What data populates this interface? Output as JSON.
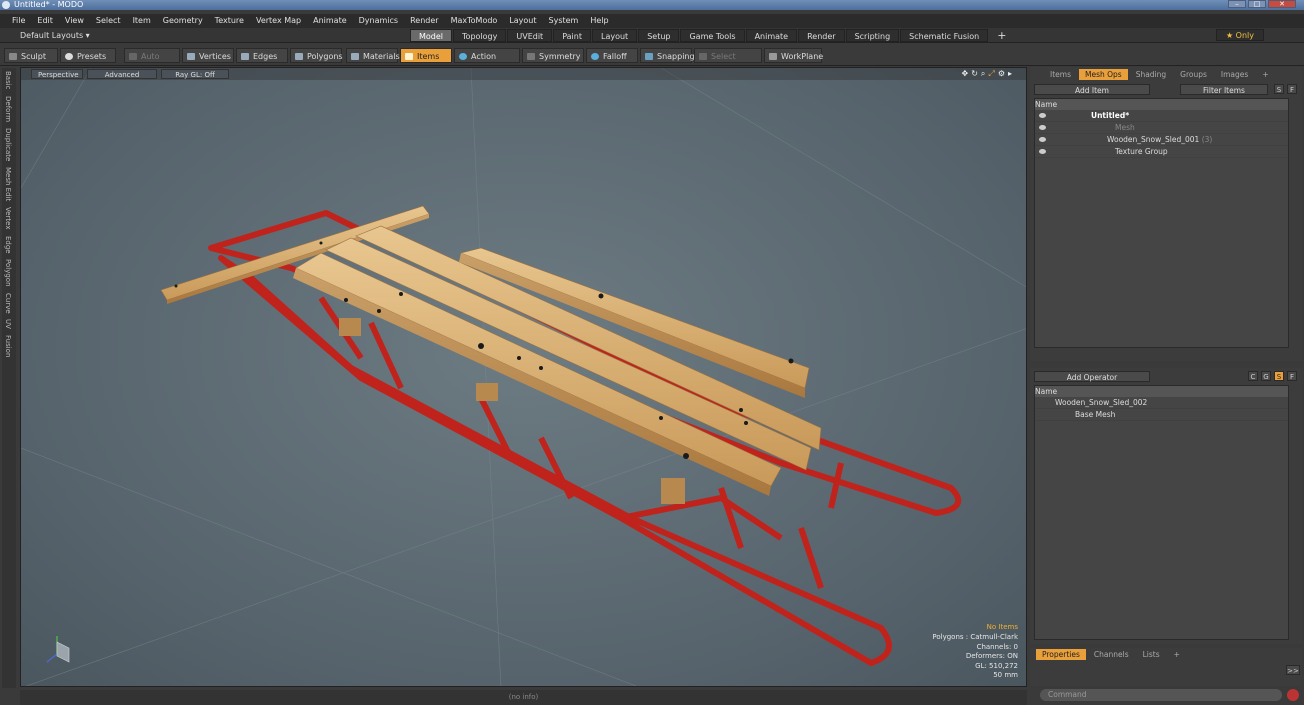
{
  "window": {
    "title": "Untitled* - MODO"
  },
  "menu": [
    "File",
    "Edit",
    "View",
    "Select",
    "Item",
    "Geometry",
    "Texture",
    "Vertex Map",
    "Animate",
    "Dynamics",
    "Render",
    "MaxToModo",
    "Layout",
    "System",
    "Help"
  ],
  "layout": {
    "dropdown": "Default Layouts ▾",
    "tabs": [
      "Model",
      "Topology",
      "UVEdit",
      "Paint",
      "Layout",
      "Setup",
      "Game Tools",
      "Animate",
      "Render",
      "Scripting",
      "Schematic Fusion"
    ],
    "active_tab": "Model",
    "plus": "+",
    "only": "★ Only"
  },
  "toolbar": {
    "sculpt": "Sculpt",
    "presets": "Presets",
    "presets_key": "F6",
    "auto_select": "Auto Select",
    "vertices": "Vertices",
    "vertices_n": "1",
    "edges": "Edges",
    "edges_n": "2",
    "polygons": "Polygons",
    "materials": "Materials",
    "items": "Items",
    "action_center": "Action Center",
    "symmetry": "Symmetry",
    "falloff": "Falloff",
    "snapping": "Snapping",
    "select_through": "Select Through",
    "workplane": "WorkPlane"
  },
  "sidetabs": [
    "Basic",
    "Deform",
    "Duplicate",
    "Mesh Edit",
    "Vertex",
    "Edge",
    "Polygon",
    "Curve",
    "UV",
    "Fusion"
  ],
  "viewport": {
    "perspective": "Perspective",
    "advanced": "Advanced",
    "raygl": "Ray GL: Off",
    "hud": {
      "noitems": "No Items",
      "polygons": "Polygons : Catmull-Clark",
      "channels": "Channels: 0",
      "deformers": "Deformers: ON",
      "gl": "GL: 510,272",
      "size": "50 mm"
    },
    "status": "(no info)"
  },
  "items_panel": {
    "tabs": [
      "Items",
      "Mesh Ops",
      "Shading",
      "Groups",
      "Images"
    ],
    "active_tab": "Mesh Ops",
    "plus": "+",
    "add_item": "Add Item",
    "filter": "Filter Items",
    "s": "S",
    "f": "F",
    "col_name": "Name",
    "rows": [
      {
        "label": "Untitled*",
        "indent": 0
      },
      {
        "label": "Mesh",
        "indent": 1
      },
      {
        "label": "Wooden_Snow_Sled_001",
        "count": "(3)",
        "indent": 1
      },
      {
        "label": "Texture Group",
        "indent": 1
      }
    ]
  },
  "ops_panel": {
    "add_operator": "Add Operator",
    "c": "C",
    "g": "G",
    "s": "S",
    "f": "F",
    "col_name": "Name",
    "rows": [
      {
        "label": "Wooden_Snow_Sled_002"
      },
      {
        "label": "Base Mesh"
      }
    ]
  },
  "props_panel": {
    "tabs": [
      "Properties",
      "Channels",
      "Lists"
    ],
    "active_tab": "Properties",
    "plus": "+",
    "expand": ">>"
  },
  "command": {
    "placeholder": "Command"
  }
}
